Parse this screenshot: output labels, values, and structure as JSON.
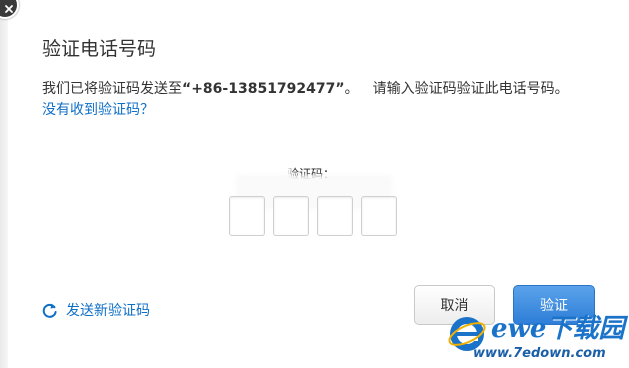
{
  "dialog": {
    "title": "验证电话号码",
    "desc_prefix": "我们已将验证码发送至",
    "phone_quoted": "“+86-13851792477”",
    "desc_suffix": "。",
    "desc_instruction": "请输入验证码验证此电话号码。",
    "not_received_link": "没有收到验证码？",
    "code_label": "验证码：",
    "code_values": [
      "",
      "",
      "",
      ""
    ],
    "resend_label": "发送新验证码",
    "cancel_label": "取消",
    "verify_label": "验证"
  },
  "watermark": {
    "title": "ewe下载园",
    "url": "www.7edown.com"
  },
  "colors": {
    "link": "#0f6fc6",
    "primary_button": "#3a8ae0",
    "text": "#333333"
  }
}
